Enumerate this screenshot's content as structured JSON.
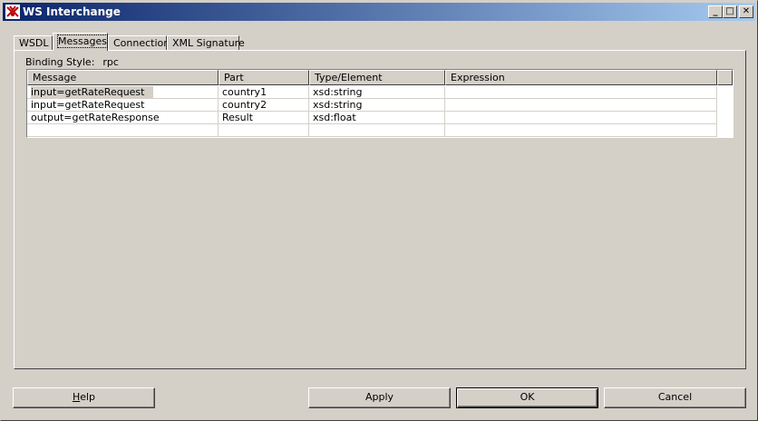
{
  "window": {
    "title": "WS Interchange",
    "minimize_glyph": "_",
    "maximize_glyph": "□",
    "close_glyph": "✕"
  },
  "tabs": [
    {
      "label": "WSDL"
    },
    {
      "label": "Messages",
      "active": true
    },
    {
      "label": "Connection"
    },
    {
      "label": "XML Signature"
    }
  ],
  "binding": {
    "label": "Binding Style:",
    "value": "rpc"
  },
  "table": {
    "columns": [
      "Message",
      "Part",
      "Type/Element",
      "Expression"
    ],
    "rows": [
      [
        "input=getRateRequest",
        "country1",
        "xsd:string",
        ""
      ],
      [
        "input=getRateRequest",
        "country2",
        "xsd:string",
        ""
      ],
      [
        "output=getRateResponse",
        "Result",
        "xsd:float",
        ""
      ],
      [
        "",
        "",
        "",
        ""
      ]
    ]
  },
  "buttons": {
    "help": {
      "mnemonic": "H",
      "rest": "elp"
    },
    "apply": "Apply",
    "ok": "OK",
    "cancel": "Cancel"
  }
}
